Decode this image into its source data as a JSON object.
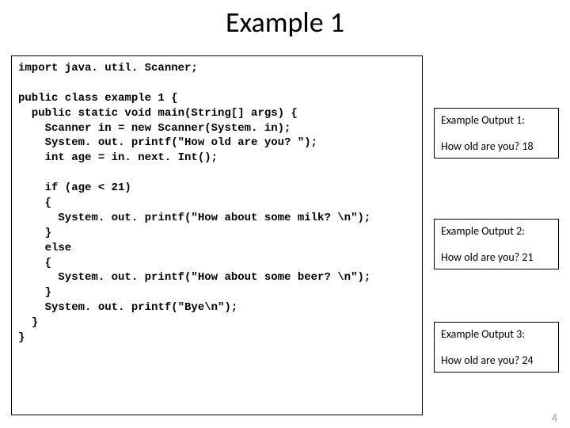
{
  "title": "Example 1",
  "code": "import java. util. Scanner;\n\npublic class example 1 {\n  public static void main(String[] args) {\n    Scanner in = new Scanner(System. in);\n    System. out. printf(\"How old are you? \");\n    int age = in. next. Int();\n\n    if (age < 21)\n    {\n      System. out. printf(\"How about some milk? \\n\");\n    }\n    else\n    {\n      System. out. printf(\"How about some beer? \\n\");\n    }\n    System. out. printf(\"Bye\\n\");\n  }\n}",
  "outputs": [
    {
      "label": "Example Output 1:",
      "text": "How old are you? 18"
    },
    {
      "label": "Example Output 2:",
      "text": "How old are you? 21"
    },
    {
      "label": "Example Output 3:",
      "text": "How old are you? 24"
    }
  ],
  "page_number": "4"
}
